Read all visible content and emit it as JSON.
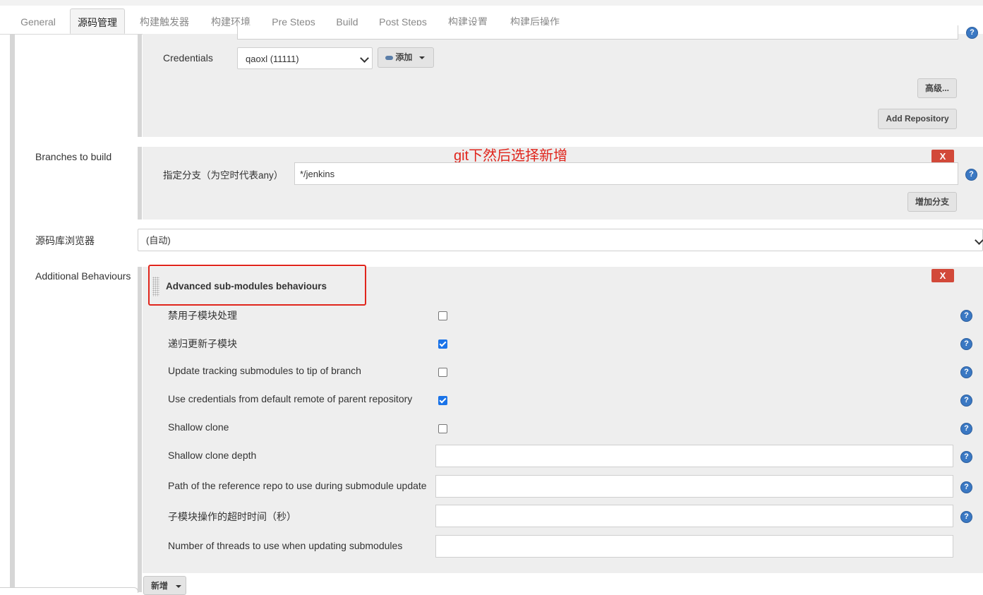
{
  "tabs": [
    "General",
    "源码管理",
    "构建触发器",
    "构建环境",
    "Pre Steps",
    "Build",
    "Post Steps",
    "构建设置",
    "构建后操作"
  ],
  "active_tab": "源码管理",
  "credentials": {
    "label": "Credentials",
    "selected": "qaoxl (11111)",
    "add_label": "添加",
    "advanced_label": "高级...",
    "add_repo_label": "Add Repository"
  },
  "branches": {
    "label": "Branches to build",
    "annotation": "git下然后选择新增",
    "delete_label": "X",
    "field_label": "指定分支（为空时代表any）",
    "value": "*/jenkins",
    "add_branch_label": "增加分支"
  },
  "browser": {
    "label": "源码库浏览器",
    "selected": "(自动)"
  },
  "behaviours": {
    "label": "Additional Behaviours",
    "title": "Advanced sub-modules behaviours",
    "delete_label": "X",
    "options": [
      {
        "label": "禁用子模块处理",
        "checked": false
      },
      {
        "label": "递归更新子模块",
        "checked": true
      },
      {
        "label": "Update tracking submodules to tip of branch",
        "checked": false
      },
      {
        "label": "Use credentials from default remote of parent repository",
        "checked": true
      },
      {
        "label": "Shallow clone",
        "checked": false
      }
    ],
    "fields": [
      {
        "label": "Shallow clone depth",
        "value": ""
      },
      {
        "label": "Path of the reference repo to use during submodule update",
        "value": ""
      },
      {
        "label": "子模块操作的超时时间（秒）",
        "value": ""
      },
      {
        "label": "Number of threads to use when updating submodules",
        "value": ""
      }
    ],
    "add_label": "新增"
  },
  "colors": {
    "annotation_red": "#e0251c",
    "delete_red": "#d24939",
    "help_blue": "#3a78c3",
    "checkbox_blue": "#1a73e8"
  }
}
